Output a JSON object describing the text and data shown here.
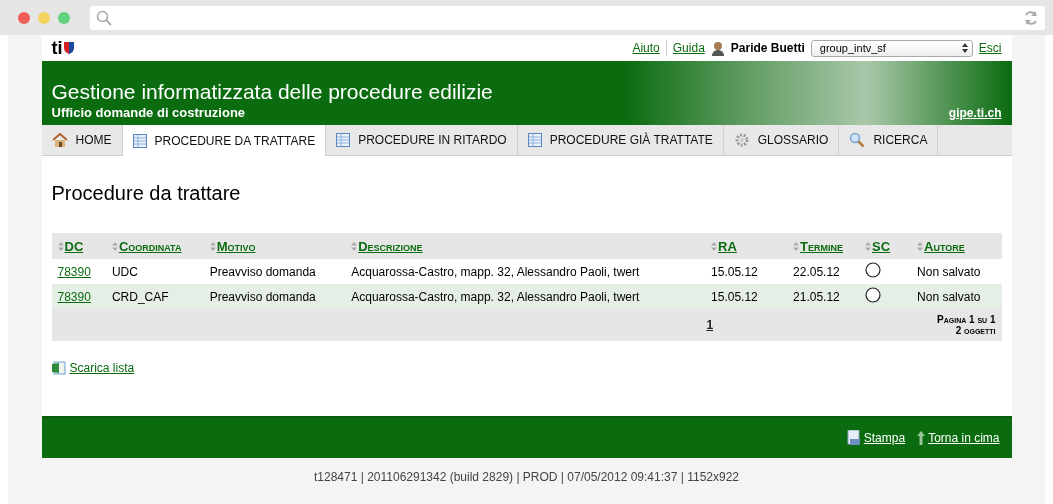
{
  "header": {
    "logo": "ti",
    "links": [
      {
        "label": "Aiuto"
      },
      {
        "label": "Guida"
      }
    ],
    "user": "Paride Buetti",
    "group_select": {
      "value": "group_intv_sf"
    },
    "logout": "Esci"
  },
  "banner": {
    "title": "Gestione informatizzata delle procedure edilizie",
    "subtitle": "Ufficio domande di costruzione",
    "site_link": "gipe.ti.ch"
  },
  "tabs": [
    {
      "label": "HOME",
      "kind": "home",
      "selected": false
    },
    {
      "label": "PROCEDURE DA TRATTARE",
      "kind": "table",
      "selected": true
    },
    {
      "label": "PROCEDURE IN RITARDO",
      "kind": "table",
      "selected": false
    },
    {
      "label": "PROCEDURE GIÀ TRATTATE",
      "kind": "table",
      "selected": false
    },
    {
      "label": "GLOSSARIO",
      "kind": "gear",
      "selected": false
    },
    {
      "label": "RICERCA",
      "kind": "search",
      "selected": false
    }
  ],
  "page_title": "Procedure da trattare",
  "table": {
    "columns": [
      "DC",
      "Coordinata",
      "Motivo",
      "Descrizione",
      "RA",
      "Termine",
      "SC",
      "Autore"
    ],
    "rows": [
      {
        "dc": "78390",
        "coordinata": "UDC",
        "motivo": "Preavviso domanda",
        "descrizione": "Acquarossa-Castro, mapp. 32, Alessandro Paoli, twert",
        "ra": "15.05.12",
        "termine": "22.05.12",
        "autore": "Non salvato"
      },
      {
        "dc": "78390",
        "coordinata": "CRD_CAF",
        "motivo": "Preavviso domanda",
        "descrizione": "Acquarossa-Castro, mapp. 32, Alessandro Paoli, twert",
        "ra": "15.05.12",
        "termine": "21.05.12",
        "autore": "Non salvato"
      }
    ],
    "pager": {
      "page_link": "1",
      "page_info": "Pagina 1 su 1",
      "count": "2 oggetti"
    }
  },
  "download_link": "Scarica lista",
  "footer": {
    "links": [
      {
        "label": "Stampa",
        "kind": "print"
      },
      {
        "label": "Torna in cima",
        "kind": "up"
      }
    ],
    "info": "t128471 | 201106291342 (build 2829) | PROD | 07/05/2012 09:41:37 | 1152x922"
  }
}
